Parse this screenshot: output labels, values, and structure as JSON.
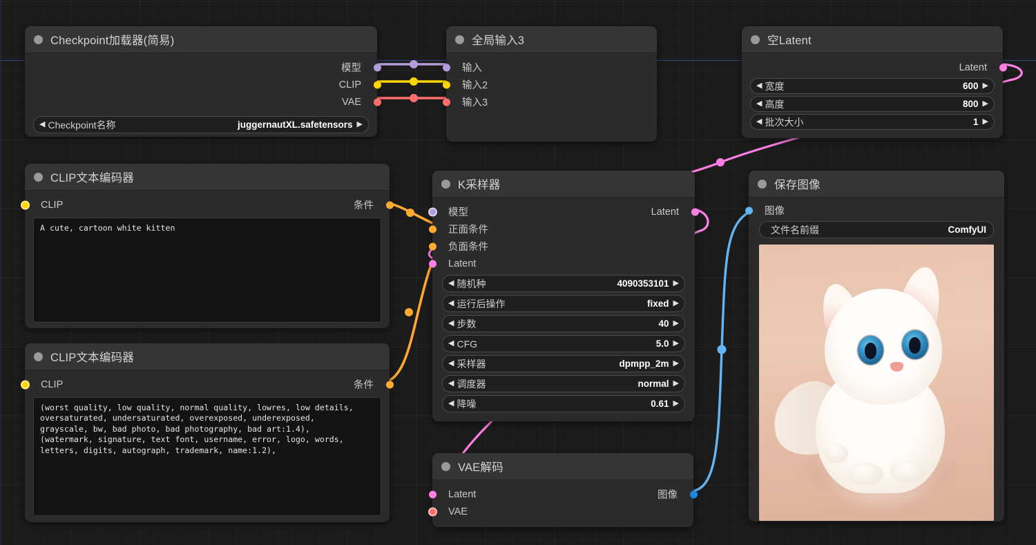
{
  "app": {
    "name": "ComfyUI",
    "canvas_background": "#1b1b1b"
  },
  "colors": {
    "model": "#b39ddb",
    "clip": "#ffd500",
    "vae": "#ff6e6e",
    "conditioning": "#ffa931",
    "latent": "#ff7fe5",
    "image": "#64b5f6",
    "node_body": "#2b2b2b",
    "node_header": "#353535"
  },
  "nodes": {
    "checkpoint_loader": {
      "title": "Checkpoint加载器(简易)",
      "outputs": [
        {
          "label": "模型",
          "type": "model"
        },
        {
          "label": "CLIP",
          "type": "clip"
        },
        {
          "label": "VAE",
          "type": "vae"
        }
      ],
      "widgets": [
        {
          "name": "Checkpoint名称",
          "value": "juggernautXL.safetensors",
          "arrows": true
        }
      ]
    },
    "global_input": {
      "title": "全局输入3",
      "inputs": [
        {
          "label": "输入",
          "type": "model"
        },
        {
          "label": "输入2",
          "type": "clip"
        },
        {
          "label": "输入3",
          "type": "vae"
        }
      ]
    },
    "empty_latent": {
      "title": "空Latent",
      "outputs": [
        {
          "label": "Latent",
          "type": "latent"
        }
      ],
      "widgets": [
        {
          "name": "宽度",
          "value": "600",
          "arrows": true
        },
        {
          "name": "高度",
          "value": "800",
          "arrows": true
        },
        {
          "name": "批次大小",
          "value": "1",
          "arrows": true
        }
      ]
    },
    "clip_encode_positive": {
      "title": "CLIP文本编码器",
      "inputs": [
        {
          "label": "CLIP",
          "type": "clip"
        }
      ],
      "outputs": [
        {
          "label": "条件",
          "type": "conditioning"
        }
      ],
      "text": "A cute, cartoon white kitten"
    },
    "clip_encode_negative": {
      "title": "CLIP文本编码器",
      "inputs": [
        {
          "label": "CLIP",
          "type": "clip"
        }
      ],
      "outputs": [
        {
          "label": "条件",
          "type": "conditioning"
        }
      ],
      "text": "(worst quality, low quality, normal quality, lowres, low details,\noversaturated, undersaturated, overexposed, underexposed,\ngrayscale, bw, bad photo, bad photography, bad art:1.4),\n(watermark, signature, text font, username, error, logo, words,\nletters, digits, autograph, trademark, name:1.2),"
    },
    "ksampler": {
      "title": "K采样器",
      "inputs": [
        {
          "label": "模型",
          "type": "model"
        },
        {
          "label": "正面条件",
          "type": "conditioning"
        },
        {
          "label": "负面条件",
          "type": "conditioning"
        },
        {
          "label": "Latent",
          "type": "latent"
        }
      ],
      "outputs": [
        {
          "label": "Latent",
          "type": "latent"
        }
      ],
      "widgets": [
        {
          "name": "随机种",
          "value": "4090353101",
          "arrows": true
        },
        {
          "name": "运行后操作",
          "value": "fixed",
          "arrows": true
        },
        {
          "name": "步数",
          "value": "40",
          "arrows": true
        },
        {
          "name": "CFG",
          "value": "5.0",
          "arrows": true
        },
        {
          "name": "采样器",
          "value": "dpmpp_2m",
          "arrows": true
        },
        {
          "name": "调度器",
          "value": "normal",
          "arrows": true
        },
        {
          "name": "降噪",
          "value": "0.61",
          "arrows": true
        }
      ]
    },
    "vae_decode": {
      "title": "VAE解码",
      "inputs": [
        {
          "label": "Latent",
          "type": "latent"
        },
        {
          "label": "VAE",
          "type": "vae"
        }
      ],
      "outputs": [
        {
          "label": "图像",
          "type": "image"
        }
      ]
    },
    "save_image": {
      "title": "保存图像",
      "inputs": [
        {
          "label": "图像",
          "type": "image"
        }
      ],
      "widgets": [
        {
          "name": "文件名前缀",
          "value": "ComfyUI",
          "arrows": false
        }
      ],
      "preview_alt": "白色小猫 / white kitten"
    }
  }
}
